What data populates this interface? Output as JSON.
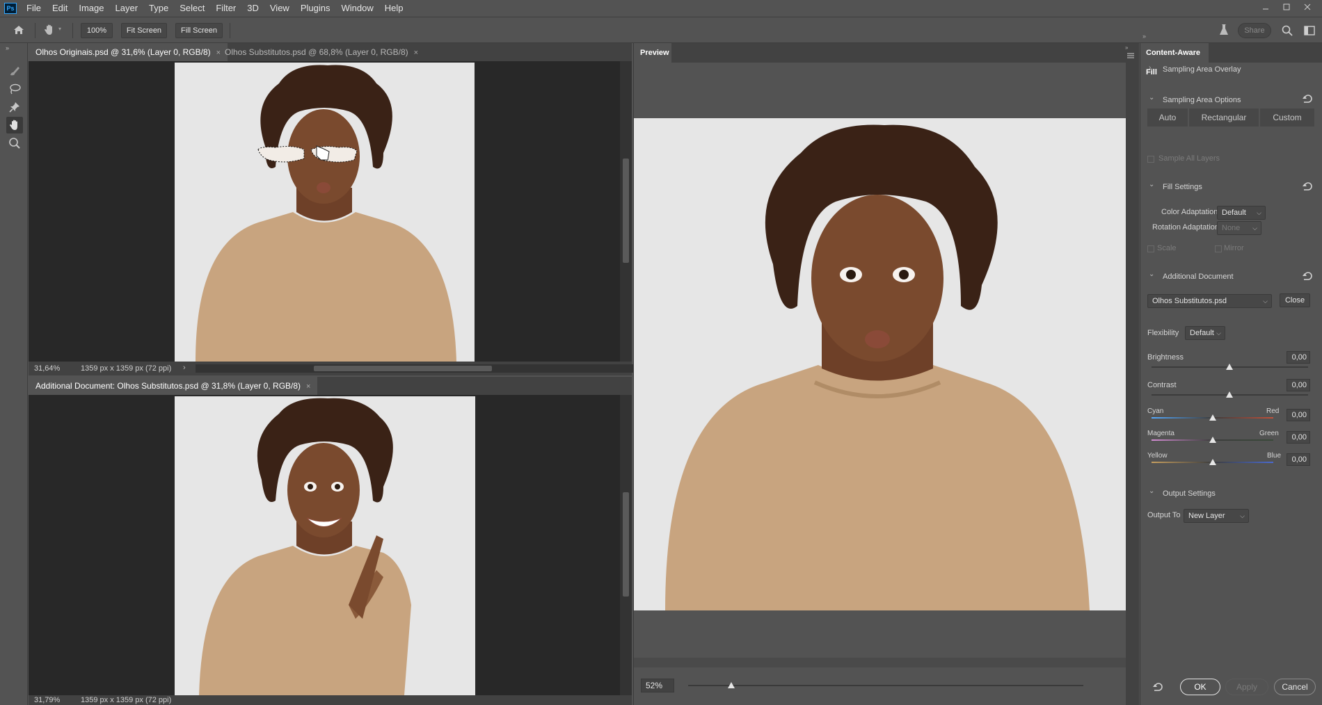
{
  "app": {
    "logo": "Ps"
  },
  "menu": [
    "File",
    "Edit",
    "Image",
    "Layer",
    "Type",
    "Select",
    "Filter",
    "3D",
    "View",
    "Plugins",
    "Window",
    "Help"
  ],
  "options_bar": {
    "zoom_button": "100%",
    "fit_screen": "Fit Screen",
    "fill_screen": "Fill Screen",
    "share": "Share"
  },
  "top_doc": {
    "tabs": [
      {
        "label": "Olhos Originais.psd @ 31,6% (Layer 0, RGB/8)",
        "close": "×"
      },
      {
        "label": "Olhos Substitutos.psd @ 68,8% (Layer 0, RGB/8)",
        "close": "×"
      }
    ],
    "zoom": "31,64%",
    "info": "1359 px x 1359 px (72 ppi)"
  },
  "bottom_doc": {
    "tab": {
      "label": "Additional Document: Olhos Substitutos.psd @ 31,8% (Layer 0, RGB/8)",
      "close": "×"
    },
    "zoom": "31,79%",
    "info": "1359 px x 1359 px (72 ppi)"
  },
  "preview": {
    "title": "Preview",
    "zoom": "52%",
    "zoom_level": 0.11
  },
  "panel": {
    "title": "Content-Aware Fill",
    "sampling_overlay": "Sampling Area Overlay",
    "sampling_options": "Sampling Area Options",
    "sampling_modes": [
      "Auto",
      "Rectangular",
      "Custom"
    ],
    "sample_all_layers": "Sample All Layers",
    "fill_settings": "Fill Settings",
    "color_adaptation_label": "Color Adaptation",
    "color_adaptation_value": "Default",
    "rotation_adaptation_label": "Rotation Adaptation",
    "rotation_adaptation_value": "None",
    "scale": "Scale",
    "mirror": "Mirror",
    "additional_document": "Additional Document",
    "doc_select": "Olhos Substitutos.psd",
    "close": "Close",
    "flexibility_label": "Flexibility",
    "flexibility_value": "Default",
    "brightness_label": "Brightness",
    "brightness_value": "0,00",
    "contrast_label": "Contrast",
    "contrast_value": "0,00",
    "cyan": "Cyan",
    "red": "Red",
    "cyan_red_value": "0,00",
    "magenta": "Magenta",
    "green": "Green",
    "magenta_green_value": "0,00",
    "yellow": "Yellow",
    "blue": "Blue",
    "yellow_blue_value": "0,00",
    "output_settings": "Output Settings",
    "output_to_label": "Output To",
    "output_to_value": "New Layer",
    "ok": "OK",
    "apply": "Apply",
    "cancel": "Cancel"
  },
  "colors": {
    "accent_blue": "#31a8ff",
    "panel_bg": "#535353",
    "canvas_bg": "#282828"
  }
}
